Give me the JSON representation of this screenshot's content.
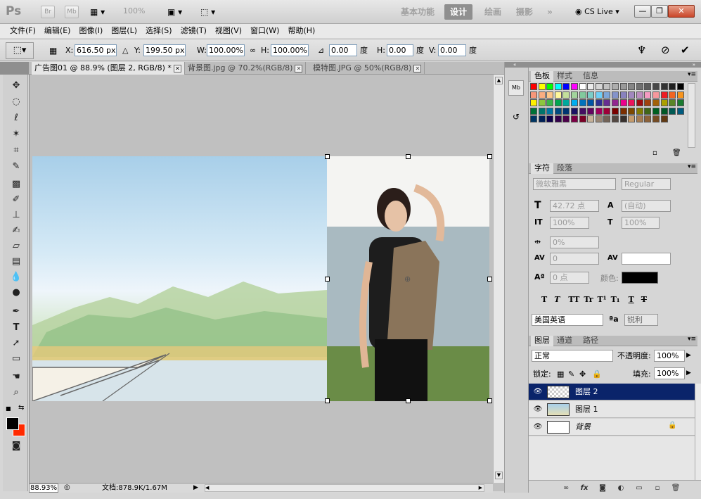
{
  "app": {
    "logo": "Ps",
    "title_buttons": [
      "Br",
      "Mb"
    ],
    "zoom_display": "100%",
    "workspaces": [
      "基本功能",
      "设计",
      "绘画",
      "摄影"
    ],
    "active_workspace": "设计",
    "more_workspaces": "»",
    "cs_live": "CS Live"
  },
  "menu": [
    "文件(F)",
    "编辑(E)",
    "图像(I)",
    "图层(L)",
    "选择(S)",
    "滤镜(T)",
    "视图(V)",
    "窗口(W)",
    "帮助(H)"
  ],
  "options": {
    "x_label": "X:",
    "x_value": "616.50 px",
    "y_label": "Y:",
    "y_value": "199.50 px",
    "w_label": "W:",
    "w_value": "100.00%",
    "h_label": "H:",
    "h_value": "100.00%",
    "angle_value": "0.00",
    "angle_unit": "度",
    "hskew_label": "H:",
    "hskew_value": "0.00",
    "hskew_unit": "度",
    "vskew_label": "V:",
    "vskew_value": "0.00",
    "vskew_unit": "度"
  },
  "doc_tabs": [
    {
      "label": "广告图01 @ 88.9% (图层 2, RGB/8) *",
      "active": true
    },
    {
      "label": "背景图.jpg @ 70.2%(RGB/8)",
      "active": false
    },
    {
      "label": "模特图.JPG @ 50%(RGB/8)",
      "active": false
    }
  ],
  "status": {
    "zoom": "88.93%",
    "doc_info": "文档:878.9K/1.67M"
  },
  "panels": {
    "swatches_tabs": [
      "色板",
      "样式",
      "信息"
    ],
    "char_tabs": [
      "字符",
      "段落"
    ],
    "font_family": "微软雅黑",
    "font_style": "Regular",
    "font_size": "42.72 点",
    "leading": "(自动)",
    "vscale": "100%",
    "hscale": "100%",
    "tracking_pct": "0%",
    "kerning": "0",
    "baseline": "0 点",
    "color_label": "颜色:",
    "style_buttons": [
      "T",
      "T",
      "TT",
      "Tr",
      "T¹",
      "T₁",
      "T",
      "T"
    ],
    "language": "美国英语",
    "aa_label": "ªa",
    "antialias": "锐利",
    "layer_tabs": [
      "图层",
      "通道",
      "路径"
    ],
    "blend_mode": "正常",
    "opacity_label": "不透明度:",
    "opacity": "100%",
    "lock_label": "锁定:",
    "fill_label": "填充:",
    "fill": "100%",
    "layers": [
      {
        "name": "图层 2",
        "selected": true
      },
      {
        "name": "图层 1",
        "selected": false
      },
      {
        "name": "背景",
        "selected": false
      }
    ]
  },
  "colors": {
    "foreground": "#000000",
    "background": "#ff2a00",
    "selection": "#0a246a"
  }
}
